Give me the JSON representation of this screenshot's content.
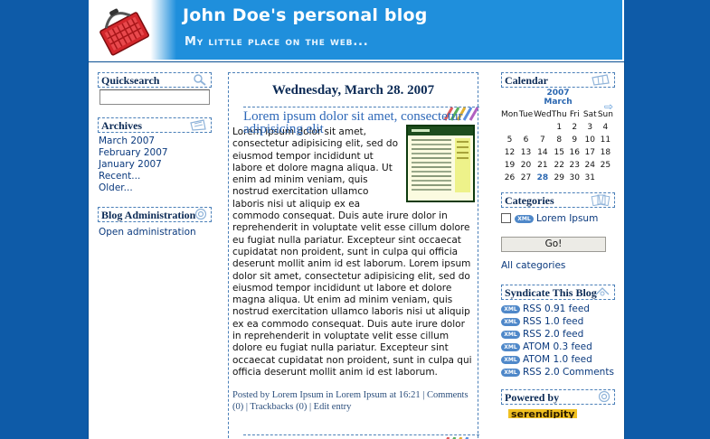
{
  "header": {
    "title": "John Doe's personal blog",
    "tagline": "My little place on the web..."
  },
  "left": {
    "quicksearch": {
      "title": "Quicksearch",
      "value": ""
    },
    "archives": {
      "title": "Archives",
      "items": [
        "March 2007",
        "February 2007",
        "January 2007",
        "Recent...",
        "Older..."
      ]
    },
    "admin": {
      "title": "Blog Administration",
      "link": "Open administration"
    }
  },
  "post": {
    "date": "Wednesday, March 28. 2007",
    "title": "Lorem ipsum dolor sit amet, consectetur adipisicing elit",
    "body": "Lorem ipsum dolor sit amet, consectetur adipisicing elit, sed do eiusmod tempor incididunt ut labore et dolore magna aliqua. Ut enim ad minim veniam, quis nostrud exercitation ullamco laboris nisi ut aliquip ex ea commodo consequat. Duis aute irure dolor in reprehenderit in voluptate velit esse cillum dolore eu fugiat nulla pariatur. Excepteur sint occaecat cupidatat non proident, sunt in culpa qui officia deserunt mollit anim id est laborum. Lorem ipsum dolor sit amet, consectetur adipisicing elit, sed do eiusmod tempor incididunt ut labore et dolore magna aliqua. Ut enim ad minim veniam, quis nostrud exercitation ullamco laboris nisi ut aliquip ex ea commodo consequat. Duis aute irure dolor in reprehenderit in voluptate velit esse cillum dolore eu fugiat nulla pariatur. Excepteur sint occaecat cupidatat non proident, sunt in culpa qui officia deserunt mollit anim id est laborum.",
    "meta": {
      "posted_by": "Posted by",
      "author": "Lorem Ipsum",
      "in": "in",
      "category": "Lorem Ipsum",
      "at": "at 16:21",
      "sep1": "|",
      "comments": "Comments (0)",
      "sep2": "|",
      "trackbacks": "Trackbacks (0)",
      "sep3": "|",
      "edit": "Edit entry"
    }
  },
  "right": {
    "calendar": {
      "title": "Calendar",
      "year": "2007",
      "month": "March",
      "next_arrow": "⇨",
      "weekdays": [
        "Mon",
        "Tue",
        "Wed",
        "Thu",
        "Fri",
        "Sat",
        "Sun"
      ],
      "weeks": [
        [
          "",
          "",
          "",
          "1",
          "2",
          "3",
          "4"
        ],
        [
          "5",
          "6",
          "7",
          "8",
          "9",
          "10",
          "11"
        ],
        [
          "12",
          "13",
          "14",
          "15",
          "16",
          "17",
          "18"
        ],
        [
          "19",
          "20",
          "21",
          "22",
          "23",
          "24",
          "25"
        ],
        [
          "26",
          "27",
          "28",
          "29",
          "30",
          "31",
          ""
        ]
      ],
      "highlight_day": "28"
    },
    "categories": {
      "title": "Categories",
      "items": [
        {
          "badge": "XML",
          "label": "Lorem Ipsum"
        }
      ],
      "go_label": "Go!",
      "all_link": "All categories"
    },
    "syndicate": {
      "title": "Syndicate This Blog",
      "feeds": [
        {
          "badge": "XML",
          "label": "RSS 0.91 feed"
        },
        {
          "badge": "XML",
          "label": "RSS 1.0 feed"
        },
        {
          "badge": "XML",
          "label": "RSS 2.0 feed"
        },
        {
          "badge": "XML",
          "label": "ATOM 0.3 feed"
        },
        {
          "badge": "XML",
          "label": "ATOM 1.0 feed"
        },
        {
          "badge": "XML",
          "label": "RSS 2.0 Comments"
        }
      ]
    },
    "powered": {
      "title": "Powered by",
      "logo_text": "serendipity"
    }
  },
  "colors": {
    "background": "#0e5ba8",
    "header": "#1f8fdc",
    "heading_text": "#0b2a55",
    "link": "#0b3a7e",
    "accent": "#2966b0"
  }
}
